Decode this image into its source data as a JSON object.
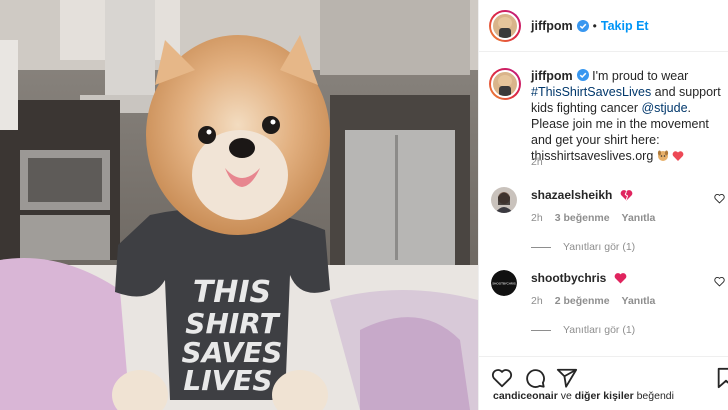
{
  "post": {
    "username": "jiffpom",
    "separator": "•",
    "follow_label": "Takip Et",
    "caption": {
      "username": "jiffpom",
      "text_part1": " I'm proud to wear ",
      "hashtag": "#ThisShirtSavesLives",
      "text_part2": " and support kids fighting cancer ",
      "mention": "@stjude",
      "text_part3": ". Please join me in the movement and get your shirt here: thisshirtsaveslives.org"
    },
    "caption_time": "2h"
  },
  "shirt_text": [
    "THIS",
    "SHIRT",
    "SAVES",
    "LIVES"
  ],
  "comments": [
    {
      "username": "shazaelsheikh",
      "time": "2h",
      "likes": "3 beğenme",
      "reply_label": "Yanıtla",
      "view_replies": "Yanıtları gör (1)"
    },
    {
      "username": "shootbychris",
      "avatar_text": "SHOOTBYCHRIS",
      "time": "2h",
      "likes": "2 beğenme",
      "reply_label": "Yanıtla",
      "view_replies": "Yanıtları gör (1)"
    }
  ],
  "footer": {
    "liker": "candiceonair",
    "connector": " ve ",
    "others": "diğer kişiler",
    "liked": " beğendi"
  },
  "colors": {
    "accent": "#0095f6",
    "verified": "#3897f0",
    "heart": "#ed4956",
    "secondary_text": "#8e8e8e"
  },
  "icons": [
    "verified-badge-icon",
    "heart-icon",
    "comment-icon",
    "share-icon",
    "bookmark-icon",
    "dog-emoji-icon",
    "heart-emoji-icon"
  ]
}
